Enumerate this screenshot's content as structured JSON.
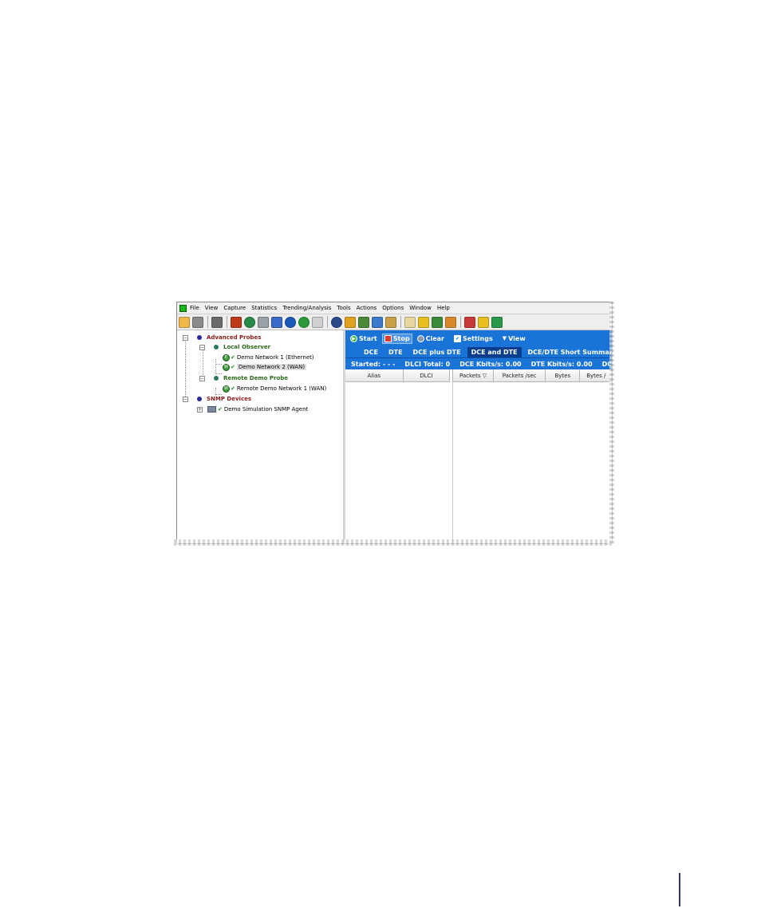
{
  "menu": {
    "items": [
      "File",
      "View",
      "Capture",
      "Statistics",
      "Trending/Analysis",
      "Tools",
      "Actions",
      "Options",
      "Window",
      "Help"
    ]
  },
  "toolbar_icons": [
    "probe-search-icon",
    "save-icon",
    "home-icon",
    "chart-icon",
    "globe-icon",
    "copy-icon",
    "calendar-icon",
    "clock-icon",
    "pause-icon",
    "stop-sound-icon",
    "refresh-icon",
    "graph-icon",
    "line-graph-icon",
    "network-icon",
    "report-icon",
    "book-icon",
    "pin-icon",
    "bucket-icon",
    "brush-icon",
    "tools-icon",
    "filter-icon",
    "monitor-icon"
  ],
  "tree": {
    "advanced_probes": "Advanced Probes",
    "local_observer": "Local Observer",
    "demo_network_1": "Demo Network 1 (Ethernet)",
    "demo_network_2": "Demo Network 2 (WAN)",
    "remote_demo_probe": "Remote Demo Probe",
    "remote_demo_network": "Remote Demo Network 1 (WAN)",
    "snmp_devices": "SNMP Devices",
    "snmp_agent": "Demo Simulation SNMP Agent"
  },
  "actions": {
    "start": "Start",
    "stop": "Stop",
    "clear": "Clear",
    "settings": "Settings",
    "view": "View"
  },
  "tabs": [
    "DCE",
    "DTE",
    "DCE plus DTE",
    "DCE and DTE",
    "DCE/DTE Short Summary"
  ],
  "active_tab": "DCE and DTE",
  "status": {
    "started": "Started:  - - -",
    "dlci_total": "DLCI Total: 0",
    "dce_kbits": "DCE Kbits/s: 0.00",
    "dte_kbits": "DTE Kbits/s: 0.00",
    "dce_l": "DCE L"
  },
  "columns": {
    "alias": "Alias",
    "dlci": "DLCI",
    "packets": "Packets ▽",
    "packets_sec": "Packets /sec",
    "bytes": "Bytes",
    "bytes2": "Bytes /"
  },
  "colors": {
    "blue_bar": "#1a73d6",
    "tree_group_red": "#8a1a1a",
    "tree_group_green": "#2a6a1a"
  }
}
